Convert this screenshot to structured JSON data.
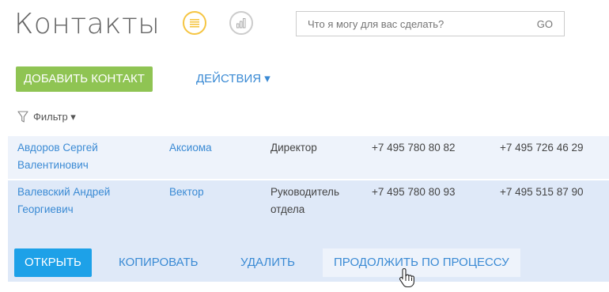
{
  "header": {
    "title": "Контакты",
    "view_list_icon": "list-icon",
    "view_chart_icon": "chart-icon"
  },
  "search": {
    "placeholder": "Что я могу для вас сделать?",
    "go_label": "GO"
  },
  "toolbar": {
    "add_label": "ДОБАВИТЬ КОНТАКТ",
    "actions_label": "ДЕЙСТВИЯ ▾"
  },
  "filter": {
    "label": "Фильтр ▾"
  },
  "rows": [
    {
      "name": "Авдоров Сергей Валентинович",
      "account": "Аксиома",
      "job": "Директор",
      "phone1": "+7 495 780 80 82",
      "phone2": "+7 495 726 46 29"
    },
    {
      "name": "Валевский Андрей Георгиевич",
      "account": "Вектор",
      "job": "Руководитель отдела",
      "phone1": "+7 495 780 80 93",
      "phone2": "+7 495 515 87 90"
    }
  ],
  "row_actions": {
    "open": "ОТКРЫТЬ",
    "copy": "КОПИРОВАТЬ",
    "delete": "УДАЛИТЬ",
    "continue": "ПРОДОЛЖИТЬ ПО ПРОЦЕССУ"
  },
  "colors": {
    "accent_green": "#8fc453",
    "accent_blue": "#1da1e8",
    "link_blue": "#3a8ad4",
    "selected_row": "#dfe9f8",
    "list_button_ring": "#f5c542"
  }
}
